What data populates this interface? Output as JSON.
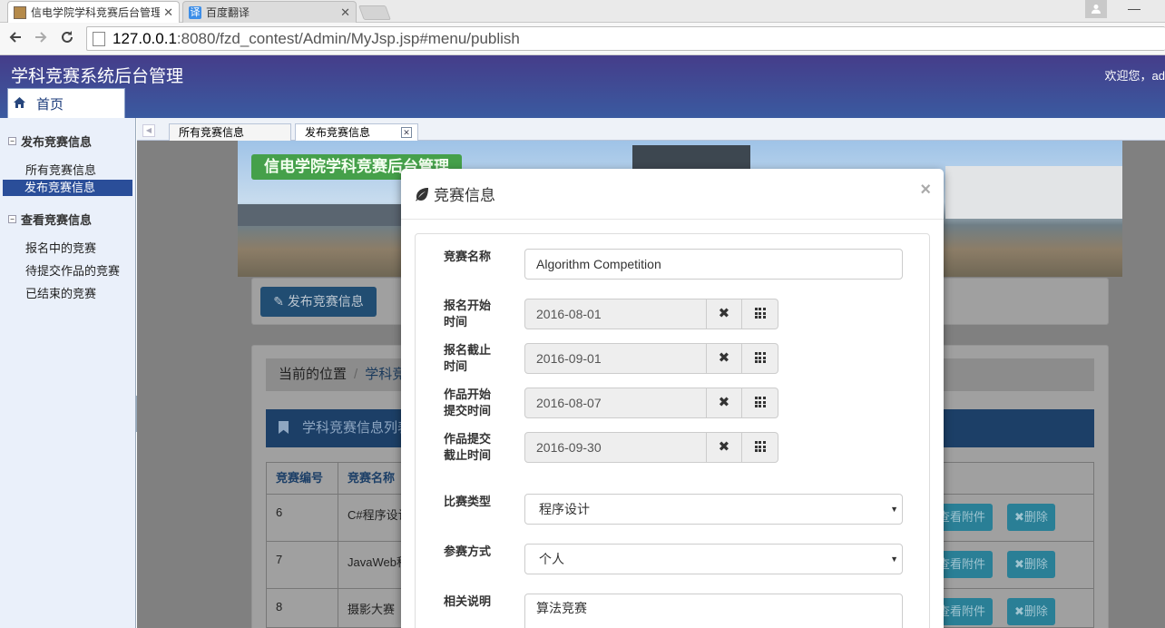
{
  "browser": {
    "tabs": [
      {
        "title": "信电学院学科竞赛后台管理"
      },
      {
        "title": "百度翻译",
        "icon_text": "译"
      }
    ],
    "address": {
      "host": "127.0.0.1",
      "rest": ":8080/fzd_contest/Admin/MyJsp.jsp#menu/publish"
    }
  },
  "app": {
    "title": "学科竞赛系统后台管理",
    "welcome": "欢迎您，ad",
    "home_tab": "首页"
  },
  "sidebar": {
    "groups": [
      {
        "label": "发布竞赛信息",
        "items": [
          {
            "label": "所有竞赛信息"
          },
          {
            "label": "发布竞赛信息",
            "selected": true
          }
        ]
      },
      {
        "label": "查看竞赛信息",
        "items": [
          {
            "label": "报名中的竞赛"
          },
          {
            "label": "待提交作品的竞赛"
          },
          {
            "label": "已结束的竞赛"
          }
        ]
      }
    ]
  },
  "content_tabs": [
    {
      "label": "所有竞赛信息"
    },
    {
      "label": "发布竞赛信息",
      "active": true
    }
  ],
  "page": {
    "banner_title": "信电学院学科竞赛后台管理",
    "publish_button": "发布竞赛信息",
    "breadcrumb": {
      "label": "当前的位置",
      "link": "学科竞"
    },
    "list_title": "学科竞赛信息列表",
    "table": {
      "headers": [
        "竞赛编号",
        "竞赛名称"
      ],
      "rows": [
        {
          "id": "6",
          "name": "C#程序设计"
        },
        {
          "id": "7",
          "name": "JavaWeb程"
        },
        {
          "id": "8",
          "name": "摄影大赛"
        }
      ],
      "attach_label": "查看附件",
      "delete_label": "删除"
    }
  },
  "modal": {
    "title": "竞赛信息",
    "close": "×",
    "fields": {
      "name": {
        "label": "竞赛名称",
        "value": "Algorithm Competition"
      },
      "reg_start": {
        "label": "报名开始时间",
        "value": "2016-08-01"
      },
      "reg_end": {
        "label": "报名截止时间",
        "value": "2016-09-01"
      },
      "sub_start": {
        "label": "作品开始提交时间",
        "value": "2016-08-07"
      },
      "sub_end": {
        "label": "作品提交截止时间",
        "value": "2016-09-30"
      },
      "type": {
        "label": "比赛类型",
        "value": "程序设计"
      },
      "mode": {
        "label": "参赛方式",
        "value": "个人"
      },
      "desc": {
        "label": "相关说明",
        "value": "算法竞赛"
      }
    }
  },
  "colors": {
    "header": "#453d8a",
    "accent": "#2a4e99",
    "overlay": "#808080"
  }
}
